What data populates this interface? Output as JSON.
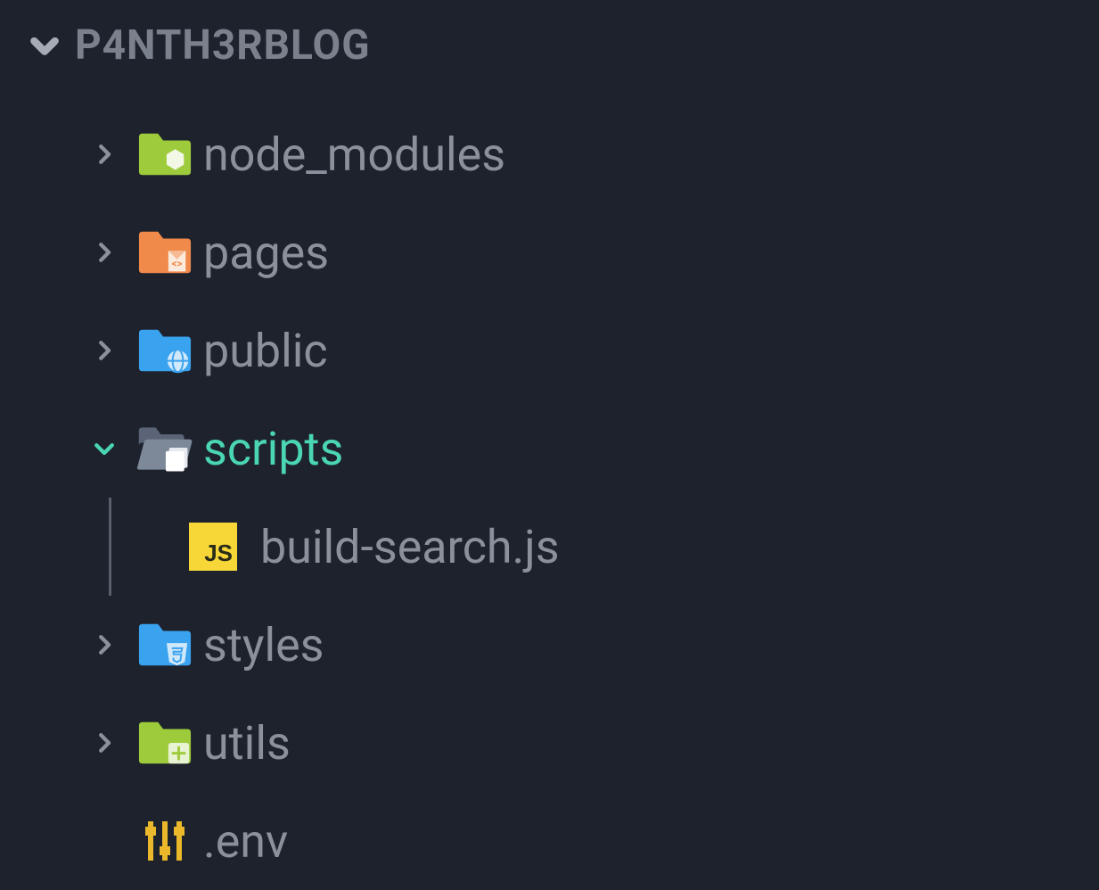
{
  "project": {
    "name": "P4NTH3RBLOG"
  },
  "tree": {
    "node_modules": {
      "label": "node_modules"
    },
    "pages": {
      "label": "pages"
    },
    "public": {
      "label": "public"
    },
    "scripts": {
      "label": "scripts"
    },
    "build_search": {
      "label": "build-search.js"
    },
    "styles": {
      "label": "styles"
    },
    "utils": {
      "label": "utils"
    },
    "env": {
      "label": ".env"
    }
  }
}
